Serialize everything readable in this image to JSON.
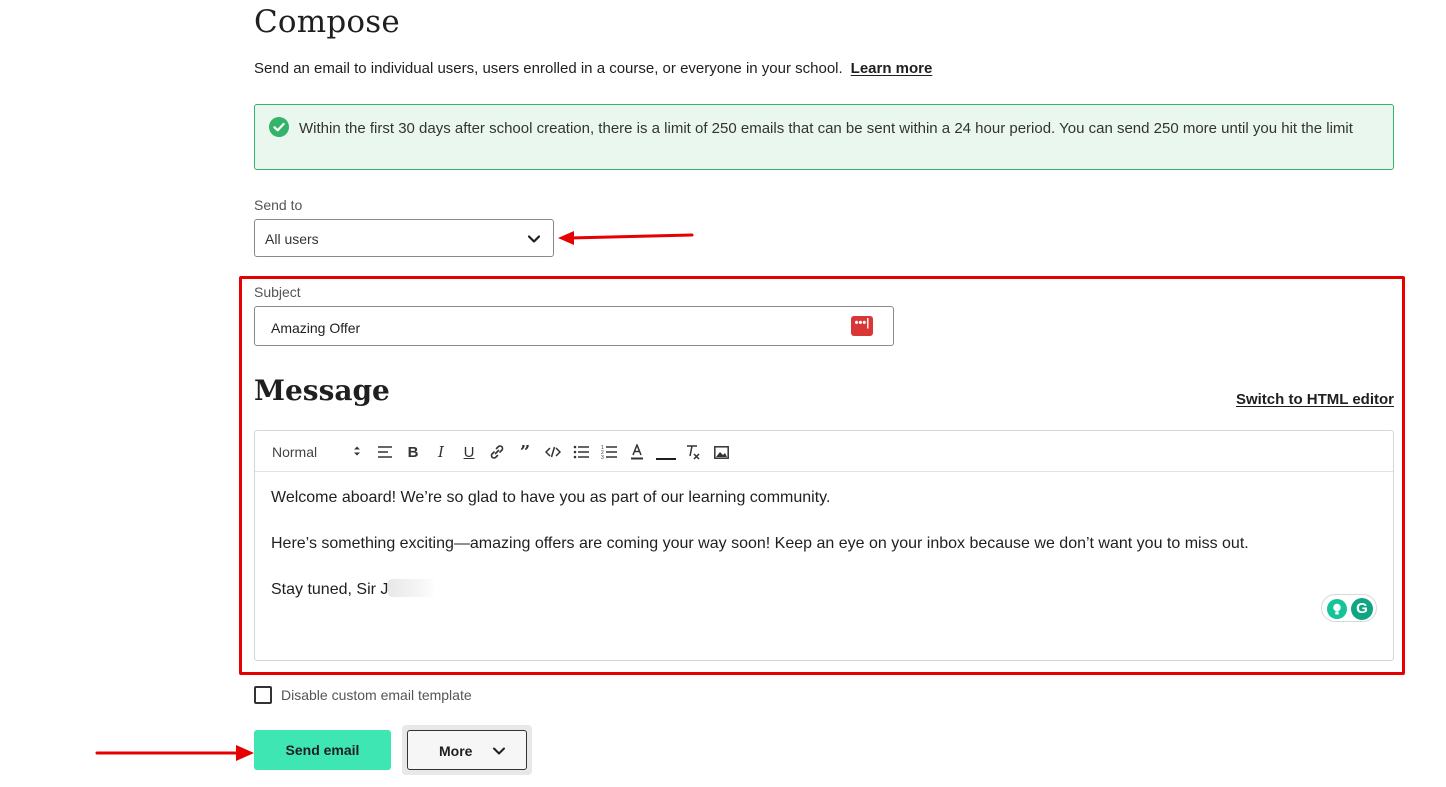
{
  "header": {
    "title": "Compose",
    "intro_text": "Send an email to individual users, users enrolled in a course, or everyone in your school.",
    "learn_more": "Learn more"
  },
  "notice": {
    "text": "Within the first 30 days after school creation, there is a limit of 250 emails that can be sent within a 24 hour period. You can send 250 more until you hit the limit",
    "icon": "check-circle-icon",
    "color": "#34b36b"
  },
  "send_to": {
    "label": "Send to",
    "value": "All users"
  },
  "subject": {
    "label": "Subject",
    "value": "Amazing Offer"
  },
  "message": {
    "title": "Message",
    "switch_link": "Switch to HTML editor",
    "toolbar": {
      "format": "Normal",
      "buttons": [
        "align-icon",
        "bold-icon",
        "italic-icon",
        "underline-icon",
        "link-icon",
        "quote-icon",
        "code-icon",
        "bullet-list-icon",
        "ordered-list-icon",
        "text-color-icon",
        "highlight-color-icon",
        "clear-format-icon",
        "image-icon"
      ]
    },
    "body": [
      "Welcome aboard! We’re so glad to have you as part of our learning community.",
      "Here’s something exciting—amazing offers are coming your way soon! Keep an eye on your inbox because we don’t want you to miss out.",
      "Stay tuned, Sir J"
    ]
  },
  "options": {
    "disable_template_label": "Disable custom email template",
    "disable_template_checked": false
  },
  "actions": {
    "send": "Send email",
    "more": "More"
  },
  "colors": {
    "accent": "#3ee6b4",
    "annotation": "#e60000"
  }
}
